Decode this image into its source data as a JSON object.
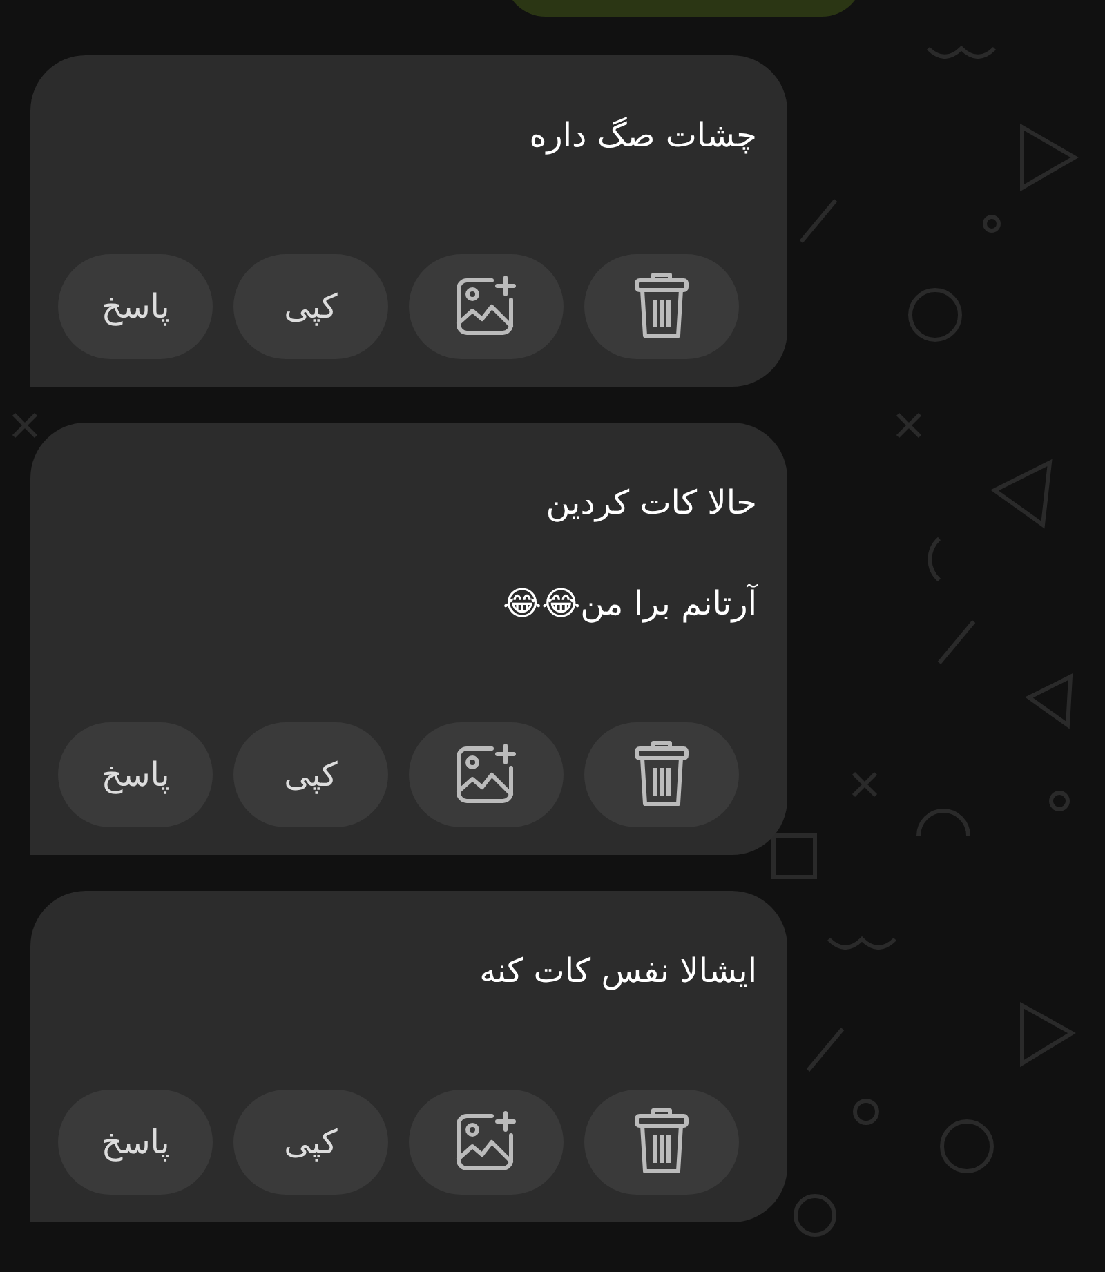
{
  "messages": [
    {
      "lines": [
        "چشات صگ داره"
      ],
      "actions": [
        {
          "kind": "delete"
        },
        {
          "kind": "add-image"
        },
        {
          "kind": "copy",
          "label": "کپی"
        },
        {
          "kind": "reply",
          "label": "پاسخ"
        }
      ]
    },
    {
      "lines": [
        "حالا کات کردین",
        "آرتانم برا من😂😂"
      ],
      "actions": [
        {
          "kind": "delete"
        },
        {
          "kind": "add-image"
        },
        {
          "kind": "copy",
          "label": "کپی"
        },
        {
          "kind": "reply",
          "label": "پاسخ"
        }
      ]
    },
    {
      "lines": [
        "ایشالا نفس کات کنه"
      ],
      "actions": [
        {
          "kind": "delete"
        },
        {
          "kind": "add-image"
        },
        {
          "kind": "copy",
          "label": "کپی"
        },
        {
          "kind": "reply",
          "label": "پاسخ"
        }
      ]
    }
  ]
}
